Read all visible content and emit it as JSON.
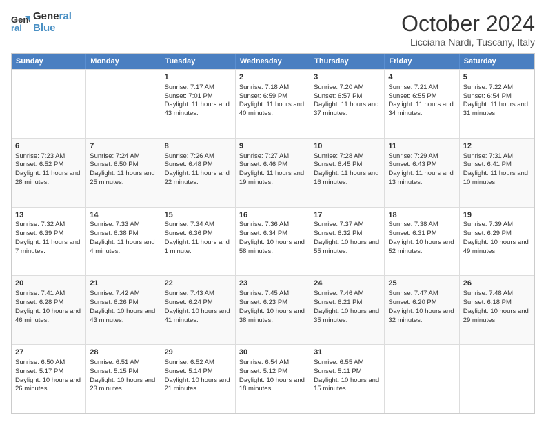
{
  "header": {
    "logo_line1": "General",
    "logo_line2": "Blue",
    "month": "October 2024",
    "location": "Licciana Nardi, Tuscany, Italy"
  },
  "days": [
    "Sunday",
    "Monday",
    "Tuesday",
    "Wednesday",
    "Thursday",
    "Friday",
    "Saturday"
  ],
  "weeks": [
    [
      {
        "day": "",
        "content": ""
      },
      {
        "day": "",
        "content": ""
      },
      {
        "day": "1",
        "content": "Sunrise: 7:17 AM\nSunset: 7:01 PM\nDaylight: 11 hours and 43 minutes."
      },
      {
        "day": "2",
        "content": "Sunrise: 7:18 AM\nSunset: 6:59 PM\nDaylight: 11 hours and 40 minutes."
      },
      {
        "day": "3",
        "content": "Sunrise: 7:20 AM\nSunset: 6:57 PM\nDaylight: 11 hours and 37 minutes."
      },
      {
        "day": "4",
        "content": "Sunrise: 7:21 AM\nSunset: 6:55 PM\nDaylight: 11 hours and 34 minutes."
      },
      {
        "day": "5",
        "content": "Sunrise: 7:22 AM\nSunset: 6:54 PM\nDaylight: 11 hours and 31 minutes."
      }
    ],
    [
      {
        "day": "6",
        "content": "Sunrise: 7:23 AM\nSunset: 6:52 PM\nDaylight: 11 hours and 28 minutes."
      },
      {
        "day": "7",
        "content": "Sunrise: 7:24 AM\nSunset: 6:50 PM\nDaylight: 11 hours and 25 minutes."
      },
      {
        "day": "8",
        "content": "Sunrise: 7:26 AM\nSunset: 6:48 PM\nDaylight: 11 hours and 22 minutes."
      },
      {
        "day": "9",
        "content": "Sunrise: 7:27 AM\nSunset: 6:46 PM\nDaylight: 11 hours and 19 minutes."
      },
      {
        "day": "10",
        "content": "Sunrise: 7:28 AM\nSunset: 6:45 PM\nDaylight: 11 hours and 16 minutes."
      },
      {
        "day": "11",
        "content": "Sunrise: 7:29 AM\nSunset: 6:43 PM\nDaylight: 11 hours and 13 minutes."
      },
      {
        "day": "12",
        "content": "Sunrise: 7:31 AM\nSunset: 6:41 PM\nDaylight: 11 hours and 10 minutes."
      }
    ],
    [
      {
        "day": "13",
        "content": "Sunrise: 7:32 AM\nSunset: 6:39 PM\nDaylight: 11 hours and 7 minutes."
      },
      {
        "day": "14",
        "content": "Sunrise: 7:33 AM\nSunset: 6:38 PM\nDaylight: 11 hours and 4 minutes."
      },
      {
        "day": "15",
        "content": "Sunrise: 7:34 AM\nSunset: 6:36 PM\nDaylight: 11 hours and 1 minute."
      },
      {
        "day": "16",
        "content": "Sunrise: 7:36 AM\nSunset: 6:34 PM\nDaylight: 10 hours and 58 minutes."
      },
      {
        "day": "17",
        "content": "Sunrise: 7:37 AM\nSunset: 6:32 PM\nDaylight: 10 hours and 55 minutes."
      },
      {
        "day": "18",
        "content": "Sunrise: 7:38 AM\nSunset: 6:31 PM\nDaylight: 10 hours and 52 minutes."
      },
      {
        "day": "19",
        "content": "Sunrise: 7:39 AM\nSunset: 6:29 PM\nDaylight: 10 hours and 49 minutes."
      }
    ],
    [
      {
        "day": "20",
        "content": "Sunrise: 7:41 AM\nSunset: 6:28 PM\nDaylight: 10 hours and 46 minutes."
      },
      {
        "day": "21",
        "content": "Sunrise: 7:42 AM\nSunset: 6:26 PM\nDaylight: 10 hours and 43 minutes."
      },
      {
        "day": "22",
        "content": "Sunrise: 7:43 AM\nSunset: 6:24 PM\nDaylight: 10 hours and 41 minutes."
      },
      {
        "day": "23",
        "content": "Sunrise: 7:45 AM\nSunset: 6:23 PM\nDaylight: 10 hours and 38 minutes."
      },
      {
        "day": "24",
        "content": "Sunrise: 7:46 AM\nSunset: 6:21 PM\nDaylight: 10 hours and 35 minutes."
      },
      {
        "day": "25",
        "content": "Sunrise: 7:47 AM\nSunset: 6:20 PM\nDaylight: 10 hours and 32 minutes."
      },
      {
        "day": "26",
        "content": "Sunrise: 7:48 AM\nSunset: 6:18 PM\nDaylight: 10 hours and 29 minutes."
      }
    ],
    [
      {
        "day": "27",
        "content": "Sunrise: 6:50 AM\nSunset: 5:17 PM\nDaylight: 10 hours and 26 minutes."
      },
      {
        "day": "28",
        "content": "Sunrise: 6:51 AM\nSunset: 5:15 PM\nDaylight: 10 hours and 23 minutes."
      },
      {
        "day": "29",
        "content": "Sunrise: 6:52 AM\nSunset: 5:14 PM\nDaylight: 10 hours and 21 minutes."
      },
      {
        "day": "30",
        "content": "Sunrise: 6:54 AM\nSunset: 5:12 PM\nDaylight: 10 hours and 18 minutes."
      },
      {
        "day": "31",
        "content": "Sunrise: 6:55 AM\nSunset: 5:11 PM\nDaylight: 10 hours and 15 minutes."
      },
      {
        "day": "",
        "content": ""
      },
      {
        "day": "",
        "content": ""
      }
    ]
  ]
}
